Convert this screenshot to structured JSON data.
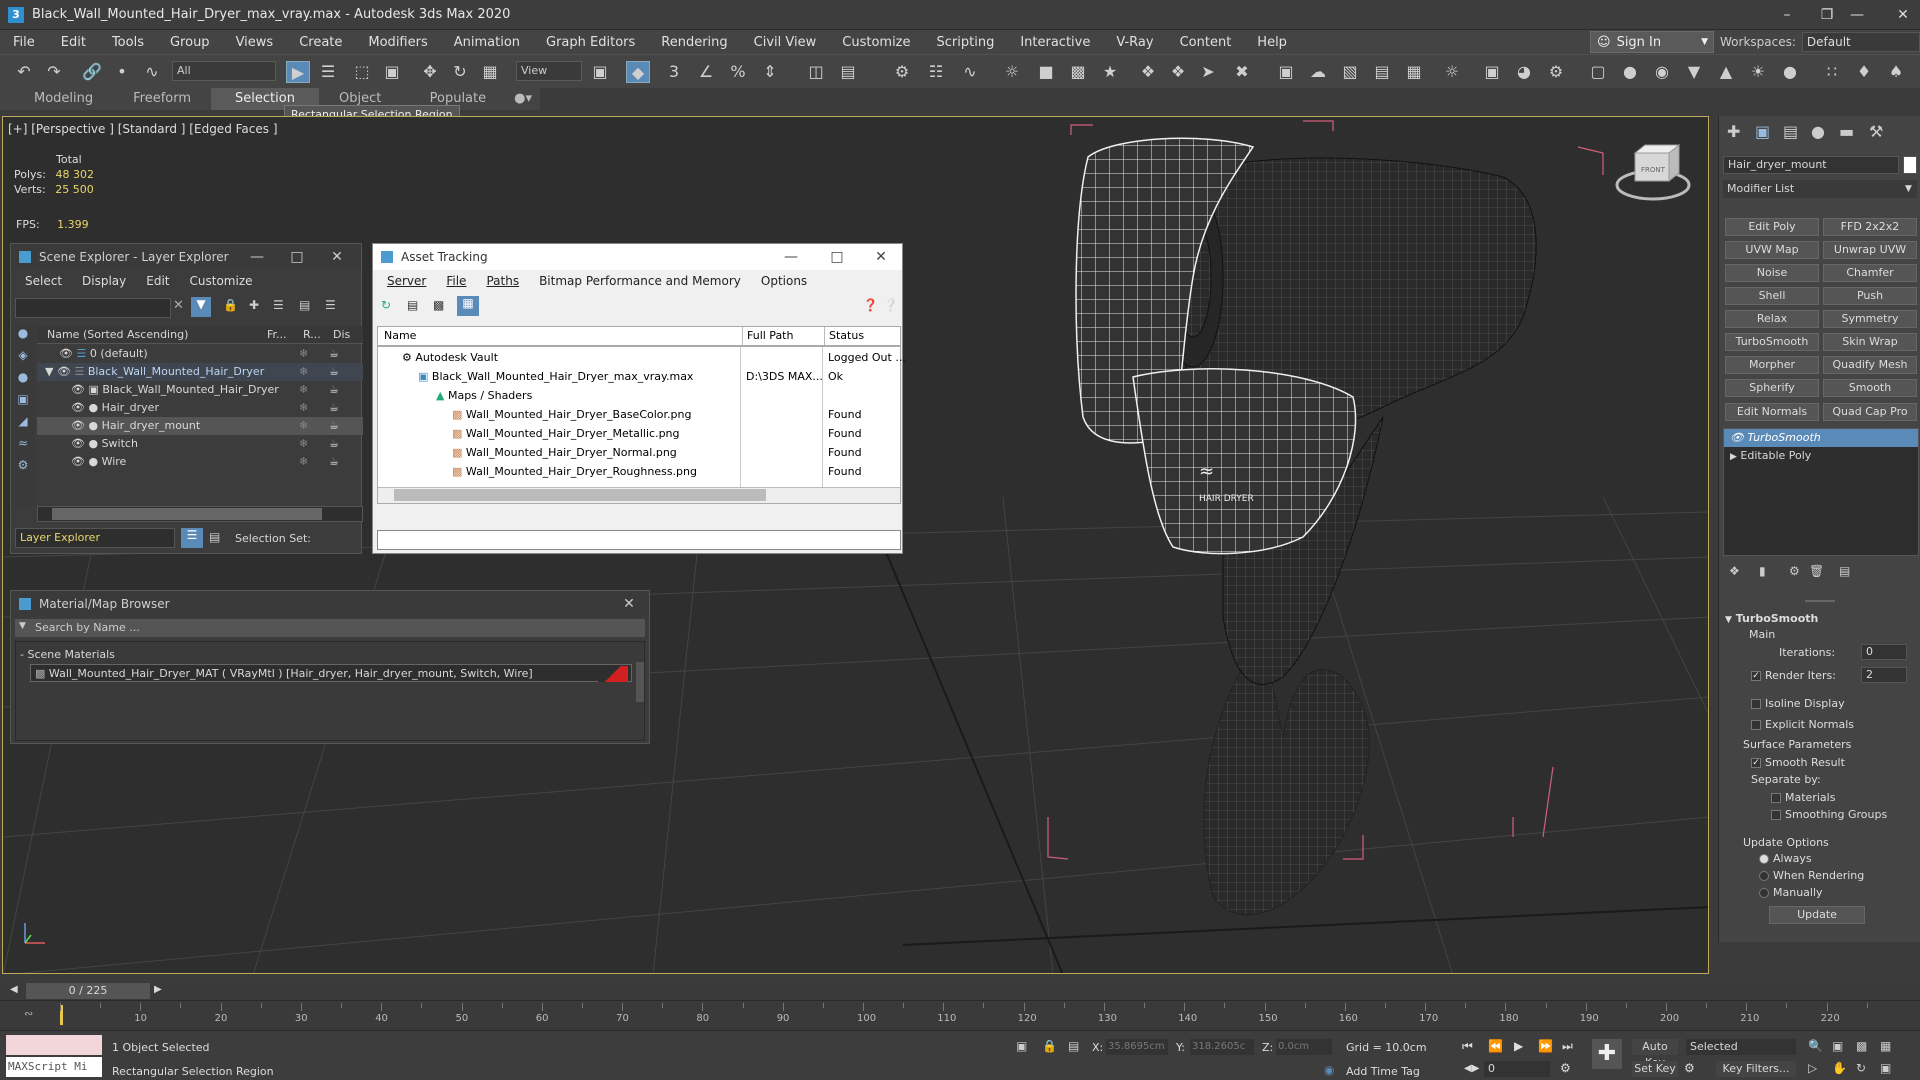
{
  "app": {
    "title": "Black_Wall_Mounted_Hair_Dryer_max_vray.max - Autodesk 3ds Max 2020",
    "logo_glyph": "3"
  },
  "menu": [
    "File",
    "Edit",
    "Tools",
    "Group",
    "Views",
    "Create",
    "Modifiers",
    "Animation",
    "Graph Editors",
    "Rendering",
    "Civil View",
    "Customize",
    "Scripting",
    "Interactive",
    "V-Ray",
    "Content",
    "Help"
  ],
  "signin": {
    "label": "Sign In"
  },
  "workspaces": {
    "label": "Workspaces:",
    "value": "Default"
  },
  "toolbar": {
    "selection_filter": "All",
    "ref_coord": "View"
  },
  "ribbon": {
    "tabs": [
      "Modeling",
      "Freeform",
      "Selection",
      "Object Paint",
      "Populate"
    ],
    "selected": "Selection"
  },
  "tooltip": "Rectangular Selection Region",
  "viewport": {
    "label": "[+] [Perspective ] [Standard ] [Edged Faces ]",
    "stats": {
      "total_label": "Total",
      "polys_label": "Polys:",
      "polys": "48 302",
      "verts_label": "Verts:",
      "verts": "25 500",
      "fps_label": "FPS:",
      "fps": "1.399"
    },
    "logo_text": "HAIR DRYER",
    "viewcube_label": "FRONT"
  },
  "scene_explorer": {
    "title": "Scene Explorer - Layer Explorer",
    "menu": [
      "Select",
      "Display",
      "Edit",
      "Customize"
    ],
    "columns": [
      "Name (Sorted Ascending)",
      "Fr...",
      "R...",
      "Dis"
    ],
    "rows": [
      {
        "name": "0 (default)",
        "indent": 0
      },
      {
        "name": "Black_Wall_Mounted_Hair_Dryer",
        "indent": 0
      },
      {
        "name": "Black_Wall_Mounted_Hair_Dryer",
        "indent": 1
      },
      {
        "name": "Hair_dryer",
        "indent": 1
      },
      {
        "name": "Hair_dryer_mount",
        "indent": 1
      },
      {
        "name": "Switch",
        "indent": 1
      },
      {
        "name": "Wire",
        "indent": 1
      }
    ],
    "footer_dropdown": "Layer Explorer",
    "selection_set_label": "Selection Set:"
  },
  "asset_tracking": {
    "title": "Asset Tracking",
    "menu": [
      "Server",
      "File",
      "Paths",
      "Bitmap Performance and Memory",
      "Options"
    ],
    "columns": [
      "Name",
      "Full Path",
      "Status"
    ],
    "rows": [
      {
        "name": "Autodesk Vault",
        "path": "",
        "status": "Logged Out ..."
      },
      {
        "name": "Black_Wall_Mounted_Hair_Dryer_max_vray.max",
        "path": "D:\\3DS MAX...",
        "status": "Ok"
      },
      {
        "name": "Maps / Shaders",
        "path": "",
        "status": ""
      },
      {
        "name": "Wall_Mounted_Hair_Dryer_BaseColor.png",
        "path": "",
        "status": "Found"
      },
      {
        "name": "Wall_Mounted_Hair_Dryer_Metallic.png",
        "path": "",
        "status": "Found"
      },
      {
        "name": "Wall_Mounted_Hair_Dryer_Normal.png",
        "path": "",
        "status": "Found"
      },
      {
        "name": "Wall_Mounted_Hair_Dryer_Roughness.png",
        "path": "",
        "status": "Found"
      }
    ]
  },
  "material_browser": {
    "title": "Material/Map Browser",
    "search_placeholder": "Search by Name ...",
    "section": "- Scene Materials",
    "item": "Wall_Mounted_Hair_Dryer_MAT  ( VRayMtl )  [Hair_dryer, Hair_dryer_mount, Switch, Wire]"
  },
  "command_panel": {
    "object_name": "Hair_dryer_mount",
    "modifier_list": "Modifier List",
    "buttons": [
      "Edit Poly",
      "FFD 2x2x2",
      "UVW Map",
      "Unwrap UVW",
      "Noise",
      "Chamfer",
      "Shell",
      "Push",
      "Relax",
      "Symmetry",
      "TurboSmooth",
      "Skin Wrap",
      "Morpher",
      "Quadify Mesh",
      "Spherify",
      "Smooth",
      "Edit Normals",
      "Quad Cap Pro"
    ],
    "stack": [
      "TurboSmooth",
      "Editable Poly"
    ],
    "rollout": {
      "title": "TurboSmooth",
      "main": "Main",
      "iterations_label": "Iterations:",
      "iterations": "0",
      "render_iters_label": "Render Iters:",
      "render_iters": "2",
      "isoline": "Isoline Display",
      "explicit_normals": "Explicit Normals",
      "surface_params": "Surface Parameters",
      "smooth_result": "Smooth Result",
      "separate_by": "Separate by:",
      "materials": "Materials",
      "smoothing_groups": "Smoothing Groups",
      "update_options": "Update Options",
      "always": "Always",
      "when_rendering": "When Rendering",
      "manually": "Manually",
      "update": "Update"
    }
  },
  "timeline": {
    "frame": "0 / 225",
    "ticks": [
      "10",
      "20",
      "30",
      "40",
      "50",
      "60",
      "70",
      "80",
      "90",
      "100",
      "110",
      "120",
      "130",
      "140",
      "150",
      "160",
      "170",
      "180",
      "190",
      "200",
      "210",
      "220"
    ]
  },
  "status": {
    "maxscript": "MAXScript Mi",
    "selected": "1 Object Selected",
    "prompt": "Rectangular Selection Region",
    "x_label": "X:",
    "x": "35.8695cm",
    "y_label": "Y:",
    "y": "318.2605c",
    "z_label": "Z:",
    "z": "0.0cm",
    "grid": "Grid = 10.0cm",
    "add_time_tag": "Add Time Tag",
    "auto_key": "Auto Key",
    "selected_dd": "Selected",
    "set_key": "Set Key",
    "key_filters": "Key Filters...",
    "frame_field": "0"
  }
}
